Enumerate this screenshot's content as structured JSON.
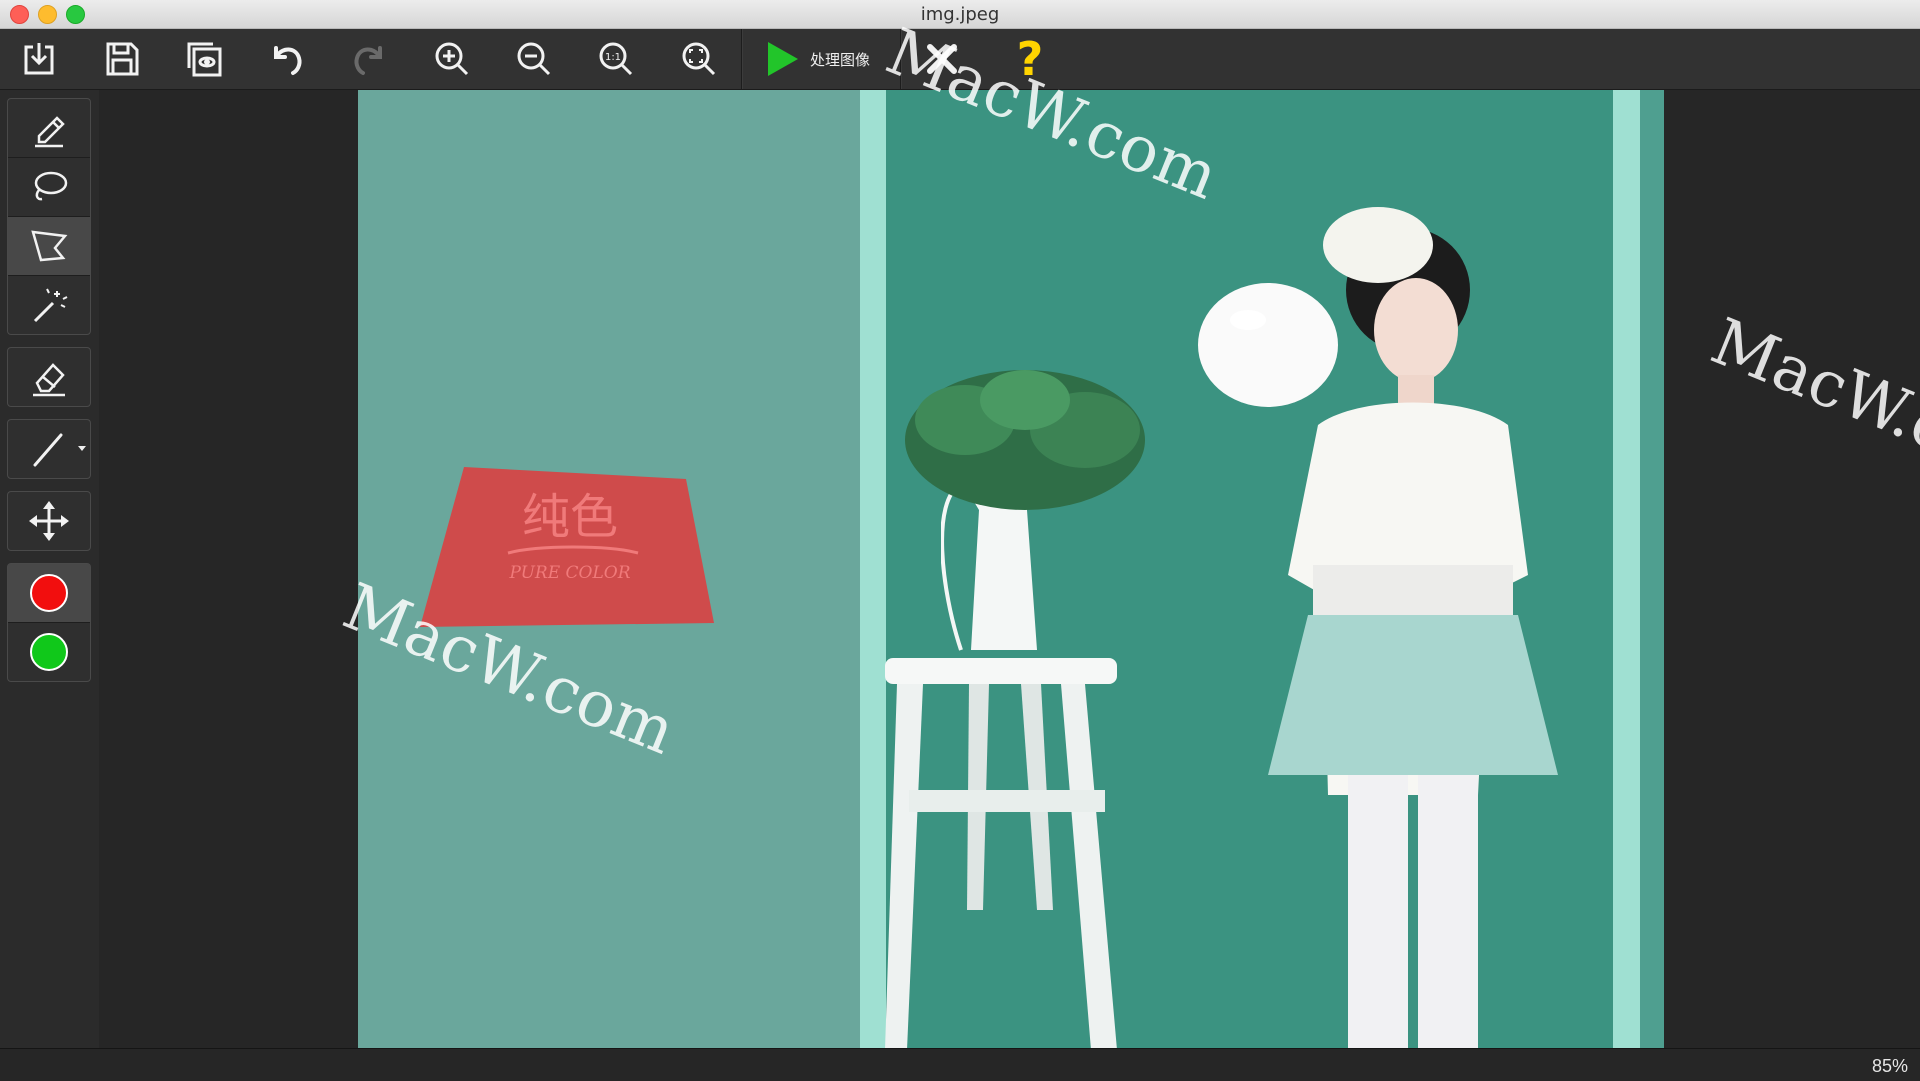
{
  "window": {
    "title": "img.jpeg"
  },
  "toolbar": {
    "buttons": [
      {
        "name": "open-button",
        "icon": "import-icon"
      },
      {
        "name": "save-button",
        "icon": "save-icon"
      },
      {
        "name": "preview-button",
        "icon": "preview-icon"
      },
      {
        "name": "undo-button",
        "icon": "undo-icon"
      },
      {
        "name": "redo-button",
        "icon": "redo-icon"
      },
      {
        "name": "zoom-in-button",
        "icon": "zoom-in-icon"
      },
      {
        "name": "zoom-out-button",
        "icon": "zoom-out-icon"
      },
      {
        "name": "actual-size-button",
        "icon": "zoom-1-1-icon",
        "text": "1:1"
      },
      {
        "name": "fit-screen-button",
        "icon": "zoom-fit-icon"
      }
    ],
    "process_label": "处理图像",
    "help_label": "?"
  },
  "tools": {
    "selected": "polygon-lasso",
    "colors": {
      "foreground": "#ff0000",
      "background": "#00cc00"
    }
  },
  "image": {
    "sign_text_cn": "纯色",
    "sign_text_en": "PURE COLOR"
  },
  "watermark": "MacW.com",
  "status": {
    "zoom": "85%"
  }
}
